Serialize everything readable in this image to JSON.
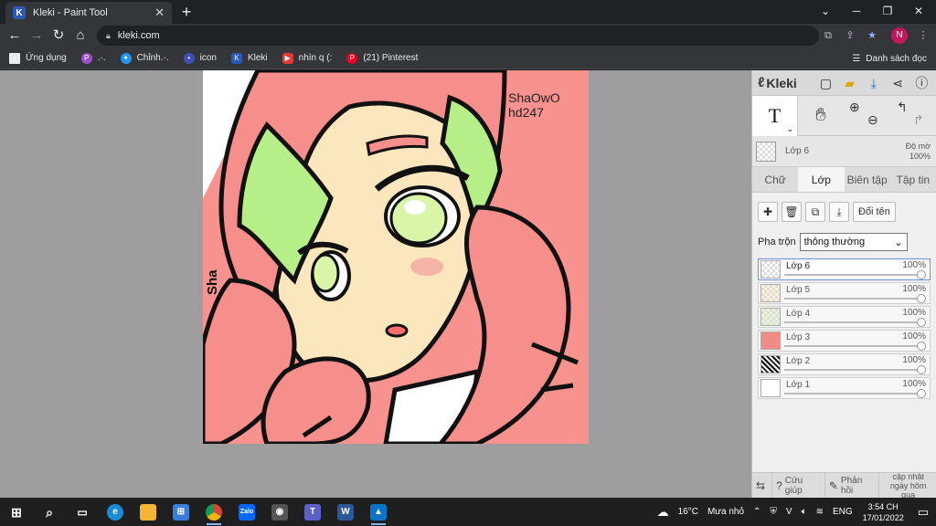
{
  "browser": {
    "tab_title": "Kleki - Paint Tool",
    "tab_favicon": "K",
    "url": "kleki.com",
    "profile_initial": "N"
  },
  "bookmarks": {
    "items": [
      {
        "label": "Ứng dụng",
        "icon": "apps-grid-icon",
        "color": "#e8eaed"
      },
      {
        "label": ".·.",
        "icon": "picsart-icon",
        "color": "#9c4dcc"
      },
      {
        "label": "Chỉnh.·.",
        "icon": "edit-app-icon",
        "color": "#2196f3"
      },
      {
        "label": "icon",
        "icon": "dot-icon",
        "color": "#3f51b5"
      },
      {
        "label": "Kleki",
        "icon": "kleki-icon",
        "color": "#2a5ab8"
      },
      {
        "label": "nhìn q (:",
        "icon": "youtube-icon",
        "color": "#e53935"
      },
      {
        "label": "(21) Pinterest",
        "icon": "pinterest-icon",
        "color": "#e60023"
      }
    ],
    "reading_list": "Danh sách đọc"
  },
  "artwork": {
    "caption_line1": "ShaOwO",
    "caption_line2": "hd247",
    "signature": "Sha",
    "bg_color": "#f7928f"
  },
  "panel": {
    "logo": "Kleki",
    "current_layer": "Lớp 6",
    "opacity_label": "Độ mờ",
    "opacity_value": "100%",
    "tabs": [
      "Chữ",
      "Lớp",
      "Biên tập",
      "Tập tin"
    ],
    "active_tab": "Lớp",
    "rename_button": "Đổi tên",
    "blend_label": "Pha trộn",
    "blend_value": "thông thường",
    "layers": [
      {
        "name": "Lớp 6",
        "opacity": "100%",
        "selected": true
      },
      {
        "name": "Lớp 5",
        "opacity": "100%",
        "selected": false
      },
      {
        "name": "Lớp 4",
        "opacity": "100%",
        "selected": false
      },
      {
        "name": "Lớp 3",
        "opacity": "100%",
        "selected": false
      },
      {
        "name": "Lớp 2",
        "opacity": "100%",
        "selected": false
      },
      {
        "name": "Lớp 1",
        "opacity": "100%",
        "selected": false
      }
    ],
    "footer": {
      "help": "Cứu giúp",
      "feedback": "Phản hồi",
      "update_line1": "cập nhật",
      "update_line2": "ngày hôm qua"
    }
  },
  "taskbar": {
    "weather_temp": "16°C",
    "weather_text": "Mưa nhỏ",
    "language": "ENG",
    "time": "3:54 CH",
    "date": "17/01/2022"
  }
}
